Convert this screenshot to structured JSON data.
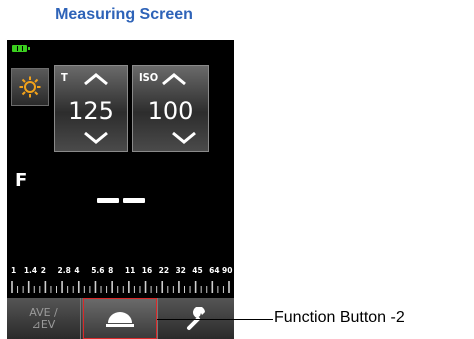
{
  "caption": "Measuring Screen",
  "status": {
    "battery_icon": "battery-full-icon",
    "battery_color": "#3bd01f"
  },
  "light_source_button": {
    "icon": "sun-icon",
    "color": "#f2a21a"
  },
  "shutter_panel": {
    "label": "T",
    "value": "125",
    "up_icon": "chevron-up-icon",
    "down_icon": "chevron-down-icon"
  },
  "iso_panel": {
    "label": "ISO",
    "value": "100",
    "up_icon": "chevron-up-icon",
    "down_icon": "chevron-down-icon"
  },
  "fstop": {
    "label": "F",
    "reading": "- -"
  },
  "fstop_scale": {
    "labels": [
      "1",
      "1.4",
      "2",
      "2.8",
      "4",
      "5.6",
      "8",
      "11",
      "16",
      "22",
      "32",
      "45",
      "64",
      "90"
    ]
  },
  "bottom_bar": {
    "ave_label_line1": "AVE /",
    "ave_label_line2": "⊿EV",
    "function2_icon": "dome-icon",
    "settings_icon": "wrench-icon"
  },
  "callout": {
    "text": "Function Button -2",
    "highlight_color": "#d92a2a"
  }
}
